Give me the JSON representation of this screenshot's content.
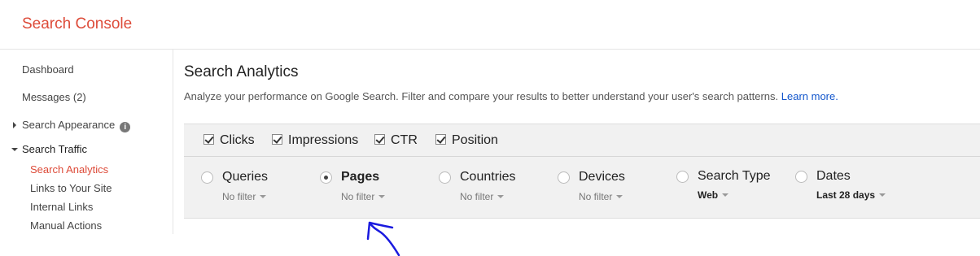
{
  "app": {
    "title": "Search Console"
  },
  "sidebar": {
    "items": [
      {
        "label": "Dashboard"
      },
      {
        "label": "Messages (2)"
      },
      {
        "label": "Search Appearance"
      },
      {
        "label": "Search Traffic"
      },
      {
        "label": "Search Analytics"
      },
      {
        "label": "Links to Your Site"
      },
      {
        "label": "Internal Links"
      },
      {
        "label": "Manual Actions"
      }
    ],
    "info_glyph": "i"
  },
  "main": {
    "title": "Search Analytics",
    "description": "Analyze your performance on Google Search. Filter and compare your results to better understand your user's search patterns.",
    "learn_more": "Learn more."
  },
  "metrics": [
    {
      "label": "Clicks",
      "checked": true
    },
    {
      "label": "Impressions",
      "checked": true
    },
    {
      "label": "CTR",
      "checked": true
    },
    {
      "label": "Position",
      "checked": true
    }
  ],
  "dimensions": [
    {
      "label": "Queries",
      "filter": "No filter",
      "selected": false
    },
    {
      "label": "Pages",
      "filter": "No filter",
      "selected": true
    },
    {
      "label": "Countries",
      "filter": "No filter",
      "selected": false
    },
    {
      "label": "Devices",
      "filter": "No filter",
      "selected": false
    },
    {
      "label": "Search Type",
      "filter": "Web",
      "selected": false
    },
    {
      "label": "Dates",
      "filter": "Last 28 days",
      "selected": false
    }
  ],
  "colors": {
    "brand": "#dd4b39",
    "link": "#1155cc",
    "annotation": "#1a1adf"
  }
}
